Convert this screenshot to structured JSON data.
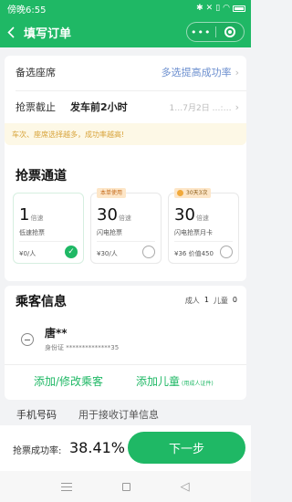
{
  "status_bar": {
    "time": "傍晚6:55",
    "icons": [
      "bluetooth-icon",
      "mute-icon",
      "vibrate-icon",
      "wifi-icon",
      "battery-icon"
    ]
  },
  "header": {
    "back_icon": "chevron-left-icon",
    "title": "填写订单",
    "more": "•••",
    "close_icon": "target-icon"
  },
  "order_options": {
    "seat": {
      "label": "备选座席",
      "value": "多选提高成功率"
    },
    "deadline": {
      "label": "抢票截止",
      "value": "发车前2小时",
      "time": "1…7月2日 …:…"
    },
    "tip": "车次、座席选择越多，成功率越高!"
  },
  "channels": {
    "title": "抢票通道",
    "items": [
      {
        "number": "1",
        "unit": "倍速",
        "name": "低速抢票",
        "price": "¥0/人",
        "badge": "",
        "selected": true
      },
      {
        "number": "30",
        "unit": "倍速",
        "name": "闪电抢票",
        "price": "¥30/人",
        "badge": "本单使用",
        "selected": false
      },
      {
        "number": "30",
        "unit": "倍速",
        "name": "闪电抢票月卡",
        "price": "¥36 价值450",
        "badge": "30天3次",
        "selected": false
      }
    ]
  },
  "passengers": {
    "title": "乘客信息",
    "adult_label": "成人",
    "adult_count": "1",
    "child_label": "儿童",
    "child_count": "0",
    "list": [
      {
        "name": "唐**",
        "id_label": "身份证",
        "id_value": "**************35"
      }
    ],
    "add_passenger": "添加/修改乘客",
    "add_child": "添加儿童",
    "add_child_note": "(用成人证件)"
  },
  "phone": {
    "label": "手机号码",
    "placeholder": "用于接收订单信息"
  },
  "footer": {
    "rate_label": "抢票成功率:",
    "rate_value": "38.41%",
    "next_button": "下一步"
  },
  "colors": {
    "brand": "#1fb865",
    "tip_bg": "#fdf8e6",
    "tip_text": "#d8a33a"
  }
}
